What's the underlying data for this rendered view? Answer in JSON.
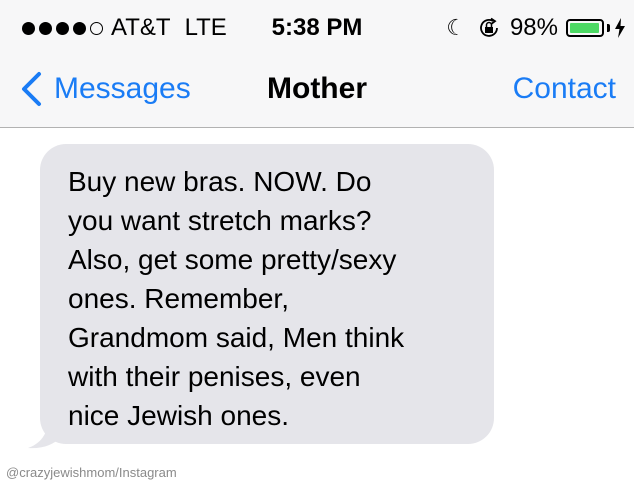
{
  "status_bar": {
    "signal_icon": "signal-dots-icon",
    "carrier": "AT&T",
    "network": "LTE",
    "time": "5:38 PM",
    "do_not_disturb_icon": "moon-icon",
    "rotation_lock_icon": "rotation-lock-icon",
    "battery_percent": "98%",
    "battery_level": 0.98,
    "charging_icon": "bolt-icon",
    "battery_color": "#4cd964"
  },
  "nav": {
    "back_label": "Messages",
    "title": "Mother",
    "contact_label": "Contact",
    "accent_color": "#1a7cf5"
  },
  "message": {
    "bubble_color": "#e5e5ea",
    "lines": [
      "Buy new bras. NOW. Do",
      "you want stretch marks?",
      "Also, get some pretty/sexy",
      "ones. Remember,",
      "Grandmom said, Men think",
      "with their penises, even",
      "nice Jewish ones."
    ]
  },
  "credit": "@crazyjewishmom/Instagram"
}
